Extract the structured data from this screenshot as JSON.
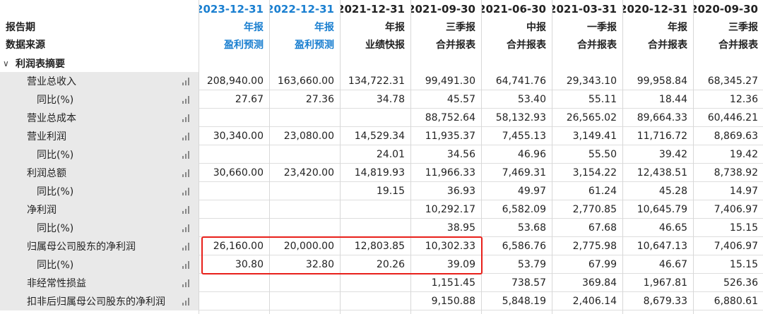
{
  "header": {
    "row_labels": [
      "报告期",
      "数据来源"
    ],
    "periods": [
      "2023-12-31",
      "2022-12-31",
      "2021-12-31",
      "2021-09-30",
      "2021-06-30",
      "2021-03-31",
      "2020-12-31",
      "2020-09-30"
    ],
    "report_types": [
      "年报",
      "年报",
      "年报",
      "三季报",
      "中报",
      "一季报",
      "年报",
      "三季报"
    ],
    "sources": [
      "盈利预测",
      "盈利预测",
      "业绩快报",
      "合并报表",
      "合并报表",
      "合并报表",
      "合并报表",
      "合并报表"
    ],
    "forecast_color": "#1a7fd0"
  },
  "section": {
    "toggle": "∨",
    "title": "利润表摘要"
  },
  "rows": [
    {
      "label": "营业总收入",
      "indent": 1,
      "values": [
        "208,940.00",
        "163,660.00",
        "134,722.31",
        "99,491.30",
        "64,741.76",
        "29,343.10",
        "99,958.84",
        "68,345.27"
      ]
    },
    {
      "label": "同比(%)",
      "indent": 2,
      "values": [
        "27.67",
        "27.36",
        "34.78",
        "45.57",
        "53.40",
        "55.11",
        "18.44",
        "12.36"
      ]
    },
    {
      "label": "营业总成本",
      "indent": 1,
      "values": [
        "",
        "",
        "",
        "88,752.64",
        "58,132.93",
        "26,565.02",
        "89,664.33",
        "60,446.21"
      ]
    },
    {
      "label": "营业利润",
      "indent": 1,
      "values": [
        "30,340.00",
        "23,080.00",
        "14,529.34",
        "11,935.37",
        "7,455.13",
        "3,149.41",
        "11,716.72",
        "8,869.63"
      ]
    },
    {
      "label": "同比(%)",
      "indent": 2,
      "values": [
        "",
        "",
        "24.01",
        "34.56",
        "46.96",
        "55.50",
        "39.42",
        "19.42"
      ]
    },
    {
      "label": "利润总额",
      "indent": 1,
      "values": [
        "30,660.00",
        "23,420.00",
        "14,819.93",
        "11,966.33",
        "7,469.31",
        "3,154.22",
        "12,438.51",
        "8,738.92"
      ]
    },
    {
      "label": "同比(%)",
      "indent": 2,
      "values": [
        "",
        "",
        "19.15",
        "36.93",
        "49.97",
        "61.24",
        "45.28",
        "14.97"
      ]
    },
    {
      "label": "净利润",
      "indent": 1,
      "values": [
        "",
        "",
        "",
        "10,292.17",
        "6,582.09",
        "2,770.85",
        "10,645.79",
        "7,406.97"
      ]
    },
    {
      "label": "同比(%)",
      "indent": 2,
      "values": [
        "",
        "",
        "",
        "38.95",
        "53.68",
        "67.68",
        "46.65",
        "15.15"
      ]
    },
    {
      "label": "归属母公司股东的净利润",
      "indent": 1,
      "values": [
        "26,160.00",
        "20,000.00",
        "12,803.85",
        "10,302.33",
        "6,586.76",
        "2,775.98",
        "10,647.13",
        "7,406.97"
      ]
    },
    {
      "label": "同比(%)",
      "indent": 2,
      "values": [
        "30.80",
        "32.80",
        "20.26",
        "39.09",
        "53.79",
        "67.99",
        "46.67",
        "15.15"
      ]
    },
    {
      "label": "非经常性损益",
      "indent": 1,
      "values": [
        "",
        "",
        "",
        "1,151.45",
        "738.57",
        "369.84",
        "1,967.81",
        "526.36"
      ]
    },
    {
      "label": "扣非后归属母公司股东的净利润",
      "indent": 1,
      "values": [
        "",
        "",
        "",
        "9,150.88",
        "5,848.19",
        "2,406.14",
        "8,679.33",
        "6,880.61"
      ]
    }
  ],
  "highlight": {
    "color": "#e8201a"
  }
}
